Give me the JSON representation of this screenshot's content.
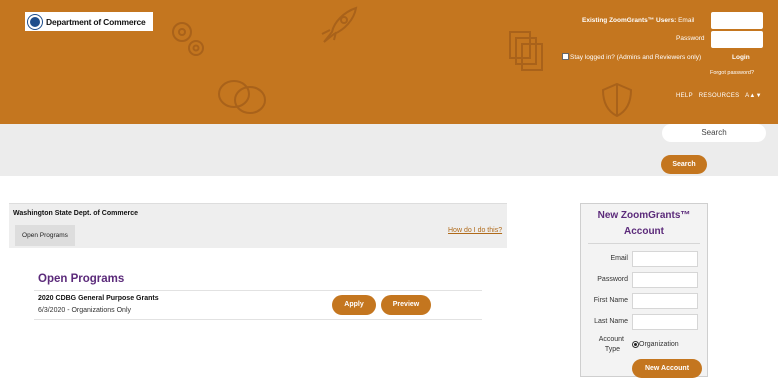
{
  "header": {
    "logo_text": "Department of Commerce",
    "existing_users_label": "Existing ZoomGrants™ Users:",
    "email_label": "Email",
    "password_label": "Password",
    "stay_logged_label": "Stay logged in? (Admins and Reviewers only)",
    "login_label": "Login",
    "forgot_label": "Forgot password?",
    "nav": [
      "HELP",
      "RESOURCES",
      "A▲▼"
    ]
  },
  "search": {
    "placeholder": "Search",
    "button_label": "Search"
  },
  "main": {
    "org_name": "Washington State Dept. of Commerce",
    "tab_label": "Open Programs",
    "how_link": "How do I do this?",
    "section_title": "Open Programs",
    "programs": [
      {
        "name": "2020 CDBG General Purpose Grants",
        "subtitle": "6/3/2020 - Organizations Only",
        "apply_label": "Apply",
        "preview_label": "Preview"
      }
    ]
  },
  "new_account": {
    "title_line1": "New ZoomGrants™",
    "title_line2": "Account",
    "fields": {
      "email": "Email",
      "password": "Password",
      "first_name": "First Name",
      "last_name": "Last Name"
    },
    "account_type_label_line1": "Account",
    "account_type_label_line2": "Type",
    "account_type_option": "Organization",
    "button_label": "New Account"
  },
  "colors": {
    "brand_orange": "#c4761f",
    "title_purple": "#5b2a7a"
  }
}
